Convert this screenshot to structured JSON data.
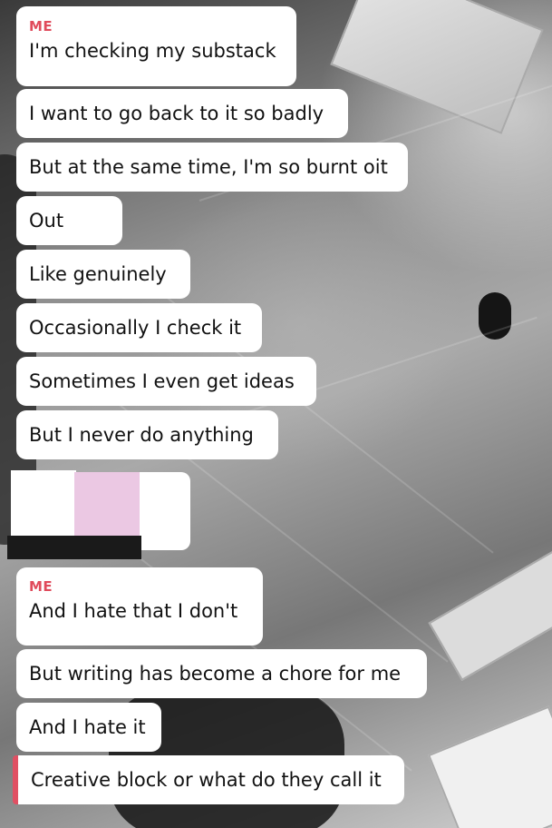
{
  "sender_label": "ME",
  "messages_group_1": [
    "I'm checking my substack",
    "I want to go back to it so badly",
    "But at the same time, I'm so burnt oit",
    "Out",
    "Like genuinely",
    "Occasionally I check it",
    "Sometimes I even get ideas",
    "But I never do anything"
  ],
  "messages_group_2": [
    "And I hate that I don't",
    "But writing has become a chore for me",
    "And I hate it",
    "Creative block or what do they call it"
  ],
  "colors": {
    "sender": "#e04a5b",
    "accent_bar": "#e05063",
    "bubble": "#ffffff",
    "redaction_pink": "#ebc8e3"
  }
}
